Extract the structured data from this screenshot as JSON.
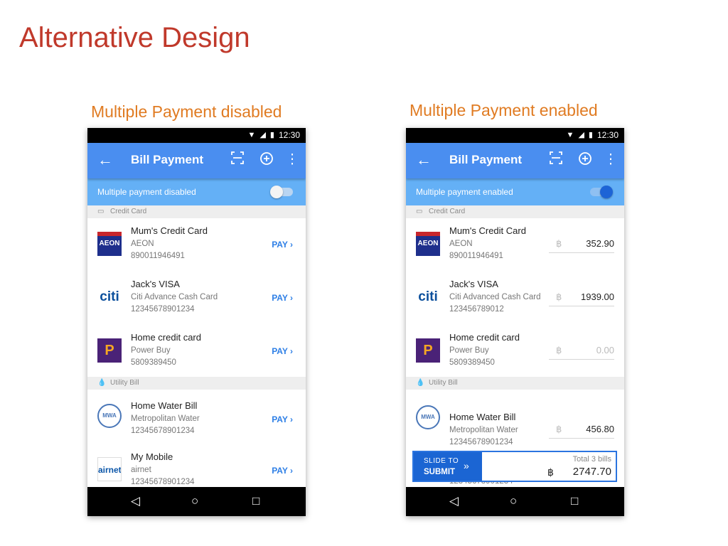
{
  "slide": {
    "title": "Alternative Design",
    "left_caption": "Multiple Payment disabled",
    "right_caption": "Multiple Payment enabled"
  },
  "status": {
    "time": "12:30"
  },
  "appbar": {
    "title": "Bill Payment",
    "back_icon": "arrow-left-icon",
    "scan_icon": "scan-icon",
    "add_icon": "add-circle-icon",
    "more_icon": "more-vert-icon"
  },
  "left": {
    "toggle_label": "Multiple payment disabled",
    "toggle_on": false,
    "sections": {
      "credit": "Credit Card",
      "utility": "Utility Bill"
    },
    "rows": [
      {
        "name": "Mum's Credit Card",
        "provider": "AEON",
        "number": "890011946491",
        "action": "PAY",
        "logo": "AEON"
      },
      {
        "name": "Jack's VISA",
        "provider": "Citi Advance Cash Card",
        "number": "12345678901234",
        "action": "PAY",
        "logo": "citi"
      },
      {
        "name": "Home credit card",
        "provider": "Power Buy",
        "number": "5809389450",
        "action": "PAY",
        "logo": "P"
      },
      {
        "name": "Home Water Bill",
        "provider": "Metropolitan Water",
        "number": "12345678901234",
        "action": "PAY",
        "logo": "MWA"
      },
      {
        "name": "My Mobile",
        "provider": "airnet",
        "number": "12345678901234",
        "action": "PAY",
        "logo": "airnet"
      }
    ]
  },
  "right": {
    "toggle_label": "Multiple payment enabled",
    "toggle_on": true,
    "sections": {
      "credit": "Credit Card",
      "utility": "Utility Bill"
    },
    "currency": "฿",
    "rows": [
      {
        "name": "Mum's Credit Card",
        "provider": "AEON",
        "number": "890011946491",
        "amount": "352.90",
        "logo": "AEON"
      },
      {
        "name": "Jack's VISA",
        "provider": "Citi Advanced Cash Card",
        "number": "123456789012",
        "amount": "1939.00",
        "logo": "citi"
      },
      {
        "name": "Home credit card",
        "provider": "Power Buy",
        "number": "5809389450",
        "amount": "0.00",
        "logo": "P"
      },
      {
        "name": "Home Water Bill",
        "provider": "Metropolitan Water",
        "number": "12345678901234",
        "amount": "456.80",
        "logo": "MWA"
      }
    ],
    "hidden_row_number": "12345678901234",
    "submit": {
      "line1": "SLIDE TO",
      "line2": "SUBMIT",
      "total_label": "Total 3 bills",
      "currency": "฿",
      "total": "2747.70"
    }
  },
  "colors": {
    "appbar": "#4a8ef0",
    "toggle_bar": "#64b0f6",
    "pay_link": "#2e7fe6",
    "title_red": "#c0392b",
    "caption_orange": "#e07b22"
  }
}
